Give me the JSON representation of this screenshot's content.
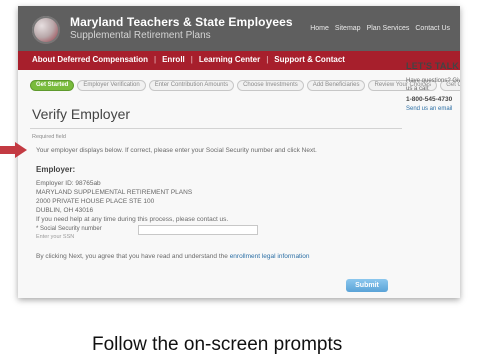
{
  "header": {
    "title_line1": "Maryland Teachers & State Employees",
    "title_line2": "Supplemental Retirement Plans",
    "util_links": [
      "Home",
      "Sitemap",
      "Plan Services",
      "Contact Us"
    ]
  },
  "nav": {
    "items": [
      "About Deferred Compensation",
      "Enroll",
      "Learning Center",
      "Support & Contact"
    ]
  },
  "steps": [
    "Get Started",
    "Employer Verification",
    "Enter Contribution Amounts",
    "Choose Investments",
    "Add Beneficiaries",
    "Review Your Choices",
    "Get Confirmation Number"
  ],
  "page": {
    "title": "Verify Employer",
    "required_label": "Required field",
    "instructions": "Your employer displays below. If correct, please enter your Social Security number and click Next.",
    "employer_heading": "Employer:",
    "employer_lines": [
      "Employer ID: 98765ab",
      "MARYLAND SUPPLEMENTAL RETIREMENT PLANS",
      "2000 PRIVATE HOUSE PLACE STE 100",
      "DUBLIN, OH 43016"
    ],
    "help_text": "If you need help at any time during this process, please contact us.",
    "ssn_label": "* Social Security number",
    "ssn_sublabel": "Enter your SSN",
    "ssn_value": "",
    "terms_prefix": "By clicking Next, you agree that you have read and understand the",
    "terms_link": "enrollment legal information",
    "submit_label": "Submit"
  },
  "sidebar": {
    "heading": "LET'S TALK",
    "lines": [
      "Have questions? Give",
      "us a call:"
    ],
    "phone": "1-800-545-4730",
    "link": "Send us an email"
  },
  "caption": "Follow the on-screen prompts"
}
